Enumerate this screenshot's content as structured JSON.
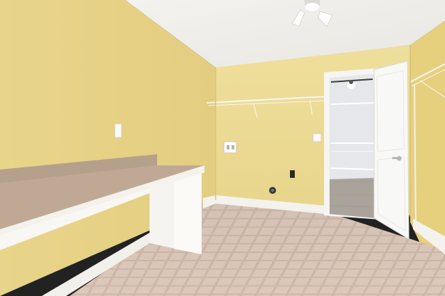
{
  "scene": {
    "kind": "photo-laundry-room-interior",
    "colors": {
      "wall": "#EBD98C",
      "wall_shadow": "#DCC676",
      "ceiling": "#F2F0EB",
      "floor_tile": "#D9C4B6",
      "floor_grout": "#C7AE9E",
      "counter_top": "#B7A08D",
      "trim": "#F6F5F1",
      "door": "#F8F8F6",
      "closet_wall": "#E7E8EA",
      "closet_floor": "#A9A39C"
    },
    "objects": [
      "ceiling-light-fixture",
      "counter-desk",
      "wall-outlet",
      "washer-box",
      "dryer-vent",
      "wire-shelf",
      "open-door",
      "closet-ceiling-fan",
      "left-wire-shelf"
    ]
  }
}
